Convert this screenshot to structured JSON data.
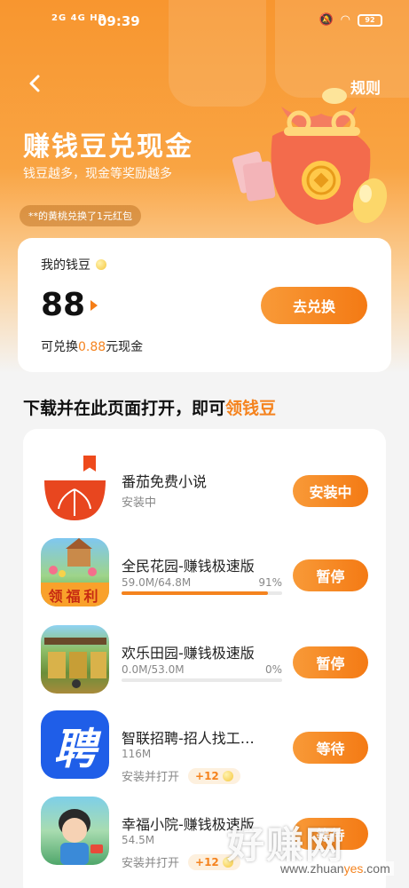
{
  "status_bar": {
    "signal": "2G  4G HD",
    "time": "09:39",
    "battery": "92"
  },
  "header": {
    "rules_label": "规则"
  },
  "hero": {
    "title": "赚钱豆兑现金",
    "subtitle": "钱豆越多，现金等奖励越多",
    "notice": "**的黄桃兑换了1元红包"
  },
  "bean_card": {
    "label": "我的钱豆",
    "value": "88",
    "cash_prefix": "可兑换",
    "cash_amount": "0.88",
    "cash_suffix": "元现金",
    "exchange_label": "去兑换"
  },
  "section": {
    "title_prefix": "下载并在此页面打开，即可",
    "title_highlight": "领钱豆"
  },
  "apps": [
    {
      "name": "番茄免费小说",
      "status": "安装中",
      "action": "安装中"
    },
    {
      "name": "全民花园-赚钱极速版",
      "progress_text": "59.0M/64.8M",
      "percent_text": "91%",
      "progress": 0.91,
      "action": "暂停",
      "icon_label": "领福利"
    },
    {
      "name": "欢乐田园-赚钱极速版",
      "progress_text": "0.0M/53.0M",
      "percent_text": "0%",
      "progress": 0.0,
      "action": "暂停"
    },
    {
      "name": "智联招聘-招人找工…",
      "size": "116M",
      "sub": "安装并打开",
      "reward": "+12",
      "action": "等待",
      "icon_glyph": "聘"
    },
    {
      "name": "幸福小院-赚钱极速版",
      "size": "54.5M",
      "sub": "安装并打开",
      "reward": "+12",
      "action": "等待"
    }
  ],
  "watermark": {
    "text": "好赚网",
    "url_prefix": "www.zhuan",
    "url_highlight": "yes",
    "url_suffix": ".com"
  },
  "colors": {
    "accent": "#f5831e",
    "hero_top": "#f8962f",
    "button_start": "#f89a38",
    "button_end": "#f47a14"
  }
}
